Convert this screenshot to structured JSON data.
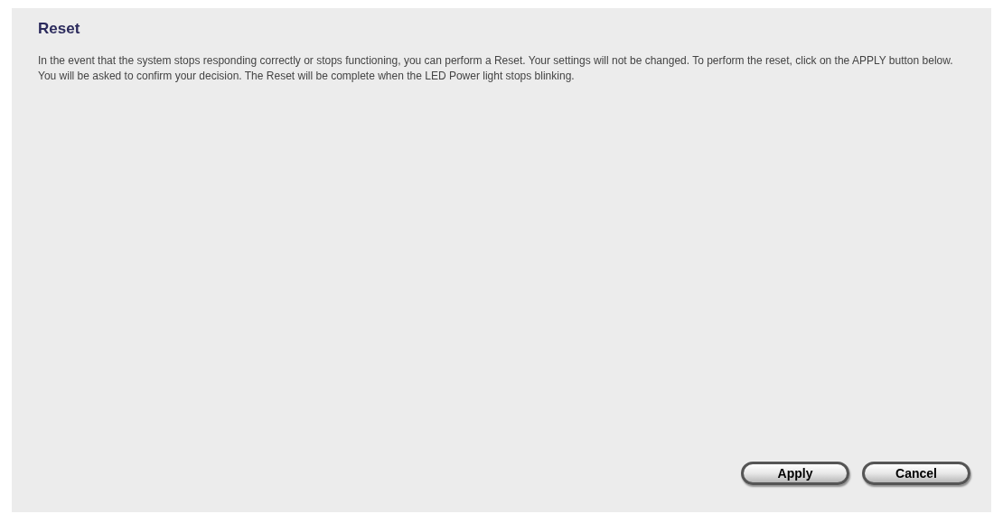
{
  "title": "Reset",
  "description": "In the event that the system stops responding correctly or stops functioning, you can perform a Reset. Your settings will not be changed. To perform the reset, click on the APPLY button below. You will be asked to confirm your decision. The Reset will be complete when the LED Power light stops blinking.",
  "buttons": [
    "Apply",
    "Cancel"
  ]
}
